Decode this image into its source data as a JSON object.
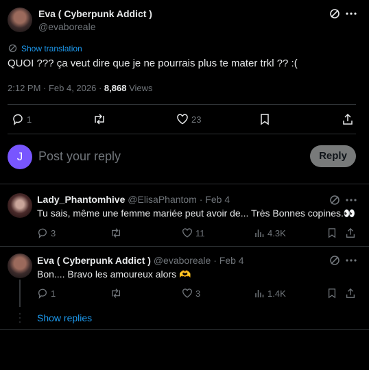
{
  "colors": {
    "accent": "#1d9bf0",
    "muted": "#71767b",
    "text": "#e7e9ea",
    "reply_avatar": "#7856ff"
  },
  "main_post": {
    "display_name": "Eva ( Cyberpunk Addict )",
    "handle": "@evaboreale",
    "show_translation": "Show translation",
    "text": "QUOI ??? ça veut dire que je ne pourrais plus te mater trkl ?? :(",
    "time": "2:12 PM · Feb 4, 2026 · ",
    "views_count": "8,868",
    "views_label": " Views",
    "replies": "1",
    "reposts": "",
    "likes": "23"
  },
  "composer": {
    "avatar_letter": "J",
    "placeholder": "Post your reply",
    "button": "Reply"
  },
  "replies": [
    {
      "display_name": "Lady_Phantomhive",
      "handle": "@ElisaPhantom",
      "date": " · Feb 4",
      "text": "Tu sais, même une femme mariée peut avoir de... Très Bonnes copines.👀",
      "replies": "3",
      "likes": "11",
      "views": "4.3K"
    },
    {
      "display_name": "Eva ( Cyberpunk Addict )",
      "handle": "@evaboreale",
      "date": " · Feb 4",
      "text": "Bon.... Bravo les amoureux alors 🫶",
      "replies": "1",
      "likes": "3",
      "views": "1.4K"
    }
  ],
  "show_replies": "Show replies"
}
